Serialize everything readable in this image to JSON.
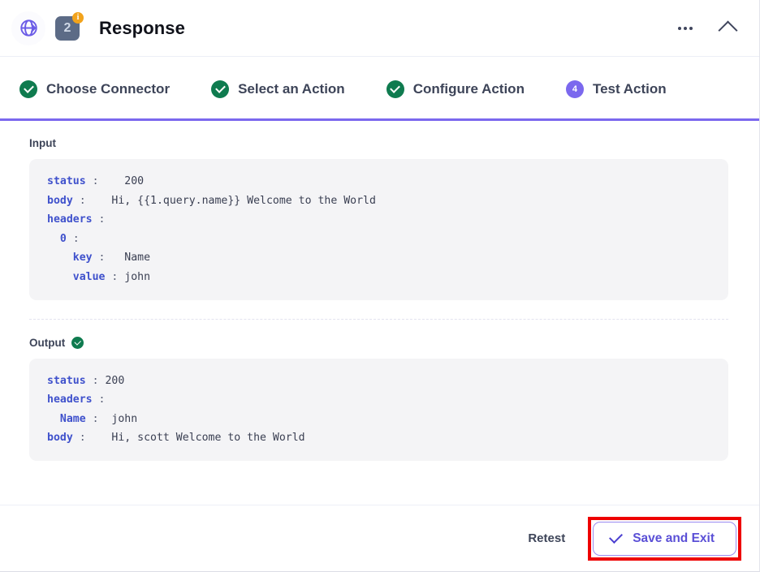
{
  "header": {
    "globe_icon": "globe-icon",
    "step_badge": "2",
    "info_badge": "i",
    "title": "Response",
    "more_icon": "ellipsis-icon",
    "collapse_icon": "chevron-up-icon"
  },
  "stepper": {
    "steps": [
      {
        "label": "Choose Connector",
        "state": "done",
        "marker": "✓"
      },
      {
        "label": "Select an Action",
        "state": "done",
        "marker": "✓"
      },
      {
        "label": "Configure Action",
        "state": "done",
        "marker": "✓"
      },
      {
        "label": "Test Action",
        "state": "active",
        "marker": "4"
      }
    ],
    "accent_color": "#7b68ee",
    "done_color": "#0f7b4f"
  },
  "input_section": {
    "label": "Input",
    "lines": [
      {
        "indent": 0,
        "key": "status",
        "colon": ":",
        "value": "200",
        "pad": 4
      },
      {
        "indent": 0,
        "key": "body",
        "colon": ":",
        "value": "Hi, {{1.query.name}} Welcome to the World",
        "pad": 4
      },
      {
        "indent": 0,
        "key": "headers",
        "colon": ":",
        "value": "",
        "pad": 0
      },
      {
        "indent": 1,
        "key": "0",
        "colon": ":",
        "value": "",
        "pad": 0
      },
      {
        "indent": 2,
        "key": "key",
        "colon": ":",
        "value": "Name",
        "pad": 3
      },
      {
        "indent": 2,
        "key": "value",
        "colon": ":",
        "value": "john",
        "pad": 1
      }
    ]
  },
  "output_section": {
    "label": "Output",
    "status_icon": "success-check-icon",
    "lines": [
      {
        "indent": 0,
        "key": "status",
        "colon": ":",
        "value": "200",
        "pad": 1
      },
      {
        "indent": 0,
        "key": "headers",
        "colon": ":",
        "value": "",
        "pad": 0
      },
      {
        "indent": 1,
        "key": "Name",
        "colon": ":",
        "value": "john",
        "pad": 2
      },
      {
        "indent": 0,
        "key": "body",
        "colon": ":",
        "value": "Hi, scott Welcome to the World",
        "pad": 4
      }
    ]
  },
  "footer": {
    "retest_label": "Retest",
    "save_label": "Save and Exit",
    "save_icon": "check-icon",
    "highlight_color": "#ee0000"
  }
}
